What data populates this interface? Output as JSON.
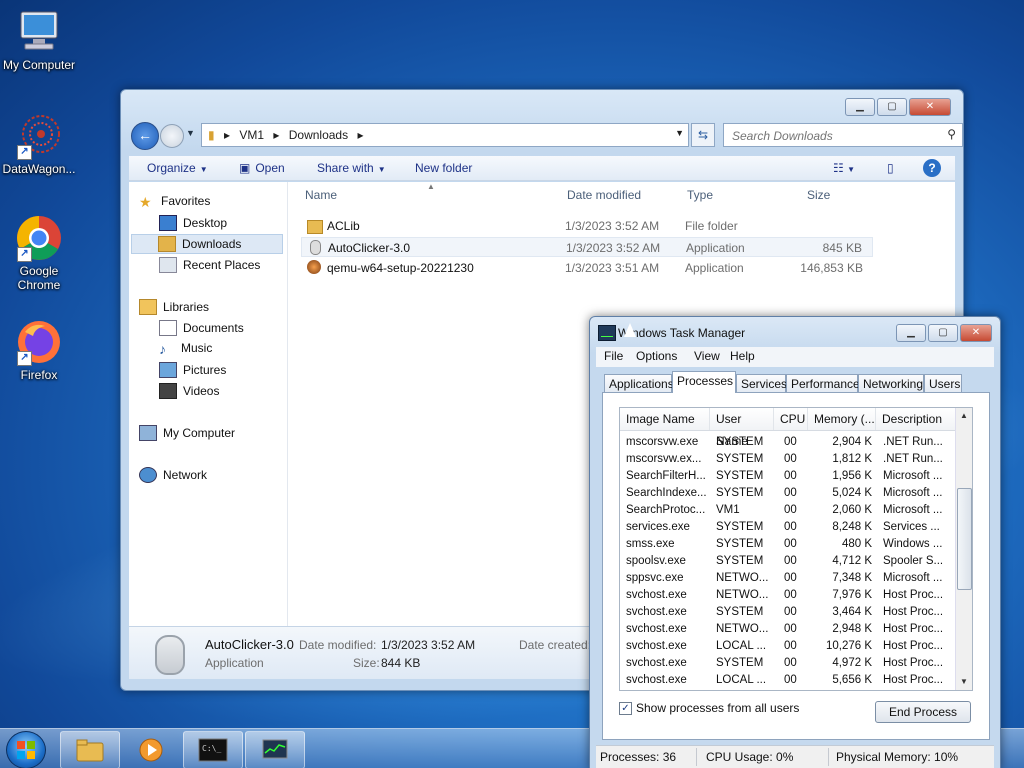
{
  "desktop": {
    "icons": [
      {
        "label": "My Computer"
      },
      {
        "label": "DataWagon..."
      },
      {
        "label": "Google Chrome"
      },
      {
        "label": "Firefox"
      }
    ]
  },
  "explorer": {
    "breadcrumbs": [
      "VM1",
      "Downloads"
    ],
    "search_placeholder": "Search Downloads",
    "toolbar": {
      "organize": "Organize",
      "open": "Open",
      "share_with": "Share with",
      "new_folder": "New folder"
    },
    "nav": {
      "favorites": "Favorites",
      "desktop": "Desktop",
      "downloads": "Downloads",
      "recent_places": "Recent Places",
      "libraries": "Libraries",
      "documents": "Documents",
      "music": "Music",
      "pictures": "Pictures",
      "videos": "Videos",
      "my_computer": "My Computer",
      "network": "Network"
    },
    "columns": {
      "name": "Name",
      "date_modified": "Date modified",
      "type": "Type",
      "size": "Size"
    },
    "files": [
      {
        "name": "ACLib",
        "date": "1/3/2023 3:52 AM",
        "type": "File folder",
        "size": ""
      },
      {
        "name": "AutoClicker-3.0",
        "date": "1/3/2023 3:52 AM",
        "type": "Application",
        "size": "845 KB"
      },
      {
        "name": "qemu-w64-setup-20221230",
        "date": "1/3/2023 3:51 AM",
        "type": "Application",
        "size": "146,853 KB"
      }
    ],
    "details": {
      "name": "AutoClicker-3.0",
      "type": "Application",
      "date_modified_label": "Date modified:",
      "date_modified": "1/3/2023 3:52 AM",
      "size_label": "Size:",
      "size": "844 KB",
      "date_created_label": "Date created:"
    }
  },
  "taskmgr": {
    "title": "Windows Task Manager",
    "menu": {
      "file": "File",
      "options": "Options",
      "view": "View",
      "help": "Help"
    },
    "tabs": [
      "Applications",
      "Processes",
      "Services",
      "Performance",
      "Networking",
      "Users"
    ],
    "active_tab": "Processes",
    "columns": {
      "image": "Image Name",
      "user": "User Name",
      "cpu": "CPU",
      "memory": "Memory (...",
      "description": "Description"
    },
    "processes": [
      {
        "image": "mscorsvw.exe",
        "user": "SYSTEM",
        "cpu": "00",
        "mem": "2,904 K",
        "desc": ".NET Run..."
      },
      {
        "image": "mscorsvw.ex...",
        "user": "SYSTEM",
        "cpu": "00",
        "mem": "1,812 K",
        "desc": ".NET Run..."
      },
      {
        "image": "SearchFilterH...",
        "user": "SYSTEM",
        "cpu": "00",
        "mem": "1,956 K",
        "desc": "Microsoft ..."
      },
      {
        "image": "SearchIndexe...",
        "user": "SYSTEM",
        "cpu": "00",
        "mem": "5,024 K",
        "desc": "Microsoft ..."
      },
      {
        "image": "SearchProtoc...",
        "user": "VM1",
        "cpu": "00",
        "mem": "2,060 K",
        "desc": "Microsoft ..."
      },
      {
        "image": "services.exe",
        "user": "SYSTEM",
        "cpu": "00",
        "mem": "8,248 K",
        "desc": "Services ..."
      },
      {
        "image": "smss.exe",
        "user": "SYSTEM",
        "cpu": "00",
        "mem": "480 K",
        "desc": "Windows ..."
      },
      {
        "image": "spoolsv.exe",
        "user": "SYSTEM",
        "cpu": "00",
        "mem": "4,712 K",
        "desc": "Spooler S..."
      },
      {
        "image": "sppsvc.exe",
        "user": "NETWO...",
        "cpu": "00",
        "mem": "7,348 K",
        "desc": "Microsoft ..."
      },
      {
        "image": "svchost.exe",
        "user": "NETWO...",
        "cpu": "00",
        "mem": "7,976 K",
        "desc": "Host Proc..."
      },
      {
        "image": "svchost.exe",
        "user": "SYSTEM",
        "cpu": "00",
        "mem": "3,464 K",
        "desc": "Host Proc..."
      },
      {
        "image": "svchost.exe",
        "user": "NETWO...",
        "cpu": "00",
        "mem": "2,948 K",
        "desc": "Host Proc..."
      },
      {
        "image": "svchost.exe",
        "user": "LOCAL ...",
        "cpu": "00",
        "mem": "10,276 K",
        "desc": "Host Proc..."
      },
      {
        "image": "svchost.exe",
        "user": "SYSTEM",
        "cpu": "00",
        "mem": "4,972 K",
        "desc": "Host Proc..."
      },
      {
        "image": "svchost.exe",
        "user": "LOCAL ...",
        "cpu": "00",
        "mem": "5,656 K",
        "desc": "Host Proc..."
      }
    ],
    "show_all_label": "Show processes from all users",
    "show_all_checked": "✓",
    "end_process": "End Process",
    "status": {
      "processes": "Processes: 36",
      "cpu": "CPU Usage: 0%",
      "memory": "Physical Memory: 10%"
    }
  },
  "colors": {
    "accent": "#1f6fc4",
    "selection": "#dde8f5"
  }
}
